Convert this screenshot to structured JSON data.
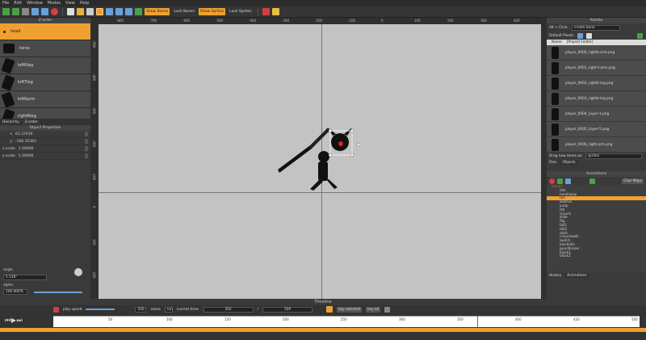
{
  "menu": [
    "File",
    "Edit",
    "Window",
    "Modes",
    "View",
    "Help"
  ],
  "toolbar": {
    "show_bones": "Show Bones",
    "lock_bones": "Lock Bones",
    "show_sprites": "Show Sprites",
    "lock_sprites": "Lock Sprites"
  },
  "left": {
    "zorder_title": "Z-order",
    "bones": [
      {
        "label": "head",
        "selected": true
      },
      {
        "label": "torso"
      },
      {
        "label": "leftRleg"
      },
      {
        "label": "leftTleg"
      },
      {
        "label": "leftRarm"
      },
      {
        "label": "rightRleg"
      }
    ],
    "tabs": [
      "Hierarchy",
      "Z-order"
    ],
    "props_title": "Object Properties",
    "props": [
      {
        "label": "x",
        "value": "63.37939"
      },
      {
        "label": "y",
        "value": "-106.35383"
      },
      {
        "label": "x-scale",
        "value": "1.00000"
      },
      {
        "label": "y-scale",
        "value": "1.00000"
      }
    ],
    "angle_label": "angle",
    "angle_value": "5.516°",
    "alpha_label": "alpha",
    "alpha_value": "100.000%"
  },
  "ruler": {
    "top": [
      "-800",
      "-700",
      "-600",
      "-500",
      "-400",
      "-300",
      "-200",
      "-100",
      "0",
      "100",
      "200",
      "300",
      "400",
      "500",
      "600"
    ],
    "left": [
      "-500",
      "-400",
      "-300",
      "-200",
      "-100",
      "0",
      "100",
      "200",
      "300"
    ]
  },
  "palette": {
    "title": "Palette",
    "alt_click": "Alt + Click:",
    "alt_value": "create bone",
    "default_pivots": "Default Pivots:",
    "name_col": "Name",
    "folder_col": "[Project Folder]",
    "items": [
      "player_0000_rightb-arm.png",
      "player_0001_right-t-arm.png",
      "player_0002_rightb-leg.png",
      "player_0003_rightb-leg.png",
      "player_0004_Layer-1.png",
      "player_0005_Layer-5.png",
      "player_0006_right-arm.png"
    ],
    "drag_label": "Drag new items as:",
    "drag_value": "sprites",
    "tabs": [
      "Files",
      "Objects"
    ]
  },
  "animations": {
    "title": "Animations",
    "char_maps": "Char Maps",
    "root": "player",
    "items": [
      "idle",
      "headswap",
      "run",
      "wallrun",
      "jump",
      "fall",
      "crouch",
      "slide",
      "flip",
      "fall1",
      "fall2",
      "dash",
      "crouchwalk",
      "switch",
      "blockidle",
      "guardbreak",
      "block1",
      "block2"
    ],
    "selected": "run",
    "tabs": [
      "History",
      "Animations"
    ]
  },
  "timeline": {
    "title": "Timeline",
    "play_speed": "play speed",
    "speed_value": "100",
    "name_label": "name",
    "name_value": "run",
    "current_time_label": "current time:",
    "current_time": "262",
    "slash": "/",
    "total_time": "500",
    "key_selected": "key selected",
    "key_all": "key all",
    "ticks": [
      "50",
      "100",
      "150",
      "200",
      "250",
      "300",
      "350",
      "400",
      "450",
      "500"
    ]
  }
}
